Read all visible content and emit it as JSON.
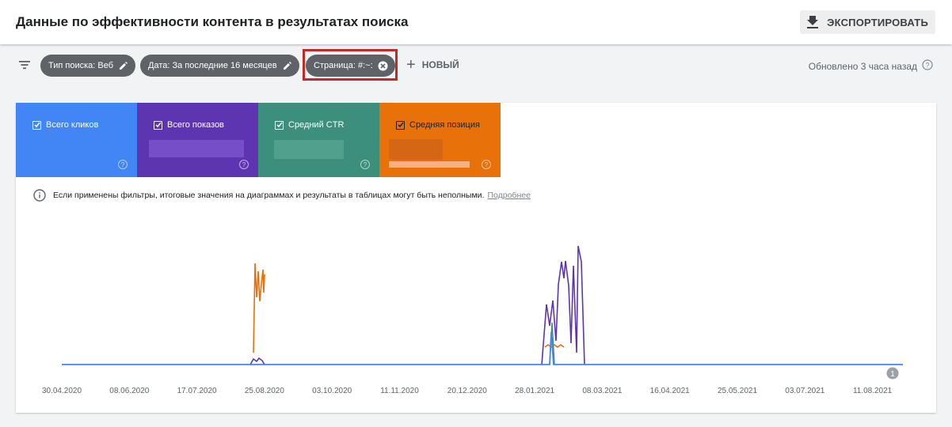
{
  "header": {
    "title": "Данные по эффективности контента в результатах поиска",
    "export_label": "ЭКСПОРТИРОВАТЬ",
    "export_icon": "download-icon"
  },
  "filters": {
    "chips": [
      {
        "label": "Тип поиска: Веб",
        "icon": "edit-icon"
      },
      {
        "label": "Дата: За последние 16 месяцев",
        "icon": "edit-icon"
      },
      {
        "label": "Страница: #:~:",
        "icon": "close-circle-icon"
      }
    ],
    "new_label": "НОВЫЙ",
    "updated": "Обновлено 3 часа назад"
  },
  "metrics": [
    {
      "label": "Всего кликов",
      "color": "#4285f4",
      "checked": true
    },
    {
      "label": "Всего показов",
      "color": "#5e35b1",
      "checked": true
    },
    {
      "label": "Средний CTR",
      "color": "#3c8f7c",
      "checked": true
    },
    {
      "label": "Средняя позиция",
      "color": "#e8710a",
      "checked": true
    }
  ],
  "notice": {
    "text": "Если применены фильтры, итоговые значения на диаграммах и результаты в таблицах могут быть неполными.",
    "link": "Подробнее"
  },
  "chart_data": {
    "type": "line",
    "x_ticks": [
      "30.04.2020",
      "08.06.2020",
      "17.07.2020",
      "25.08.2020",
      "03.10.2020",
      "11.11.2020",
      "20.12.2020",
      "28.01.2021",
      "08.03.2021",
      "16.04.2021",
      "25.05.2021",
      "03.07.2021",
      "11.08.2021"
    ],
    "annotation": "1",
    "series": []
  }
}
